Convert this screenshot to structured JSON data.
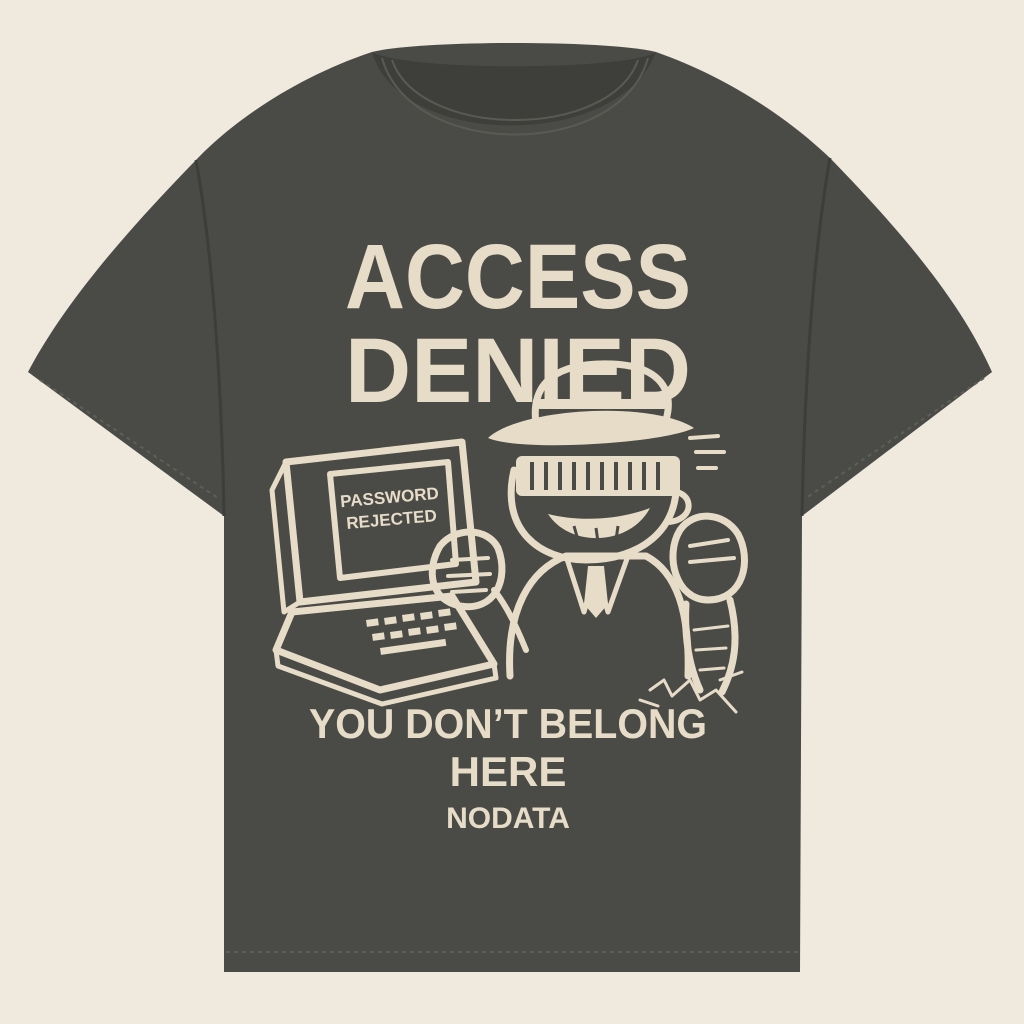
{
  "colors": {
    "background": "#efe9de",
    "shirt": "#4a4a46",
    "shirt_shadow": "#3e3e3b",
    "print_ink": "#e6dcc7"
  },
  "print": {
    "headline_line1": "ACCESS",
    "headline_line2": "DENIED",
    "screen_line1": "PASSWORD",
    "screen_line2": "REJECTED",
    "tagline_line1": "YOU DON’T BELONG",
    "tagline_line2": "HERE",
    "brand": "NODATA"
  },
  "icons": [
    "computer-icon",
    "keyboard-icon",
    "hacker-character-icon"
  ]
}
